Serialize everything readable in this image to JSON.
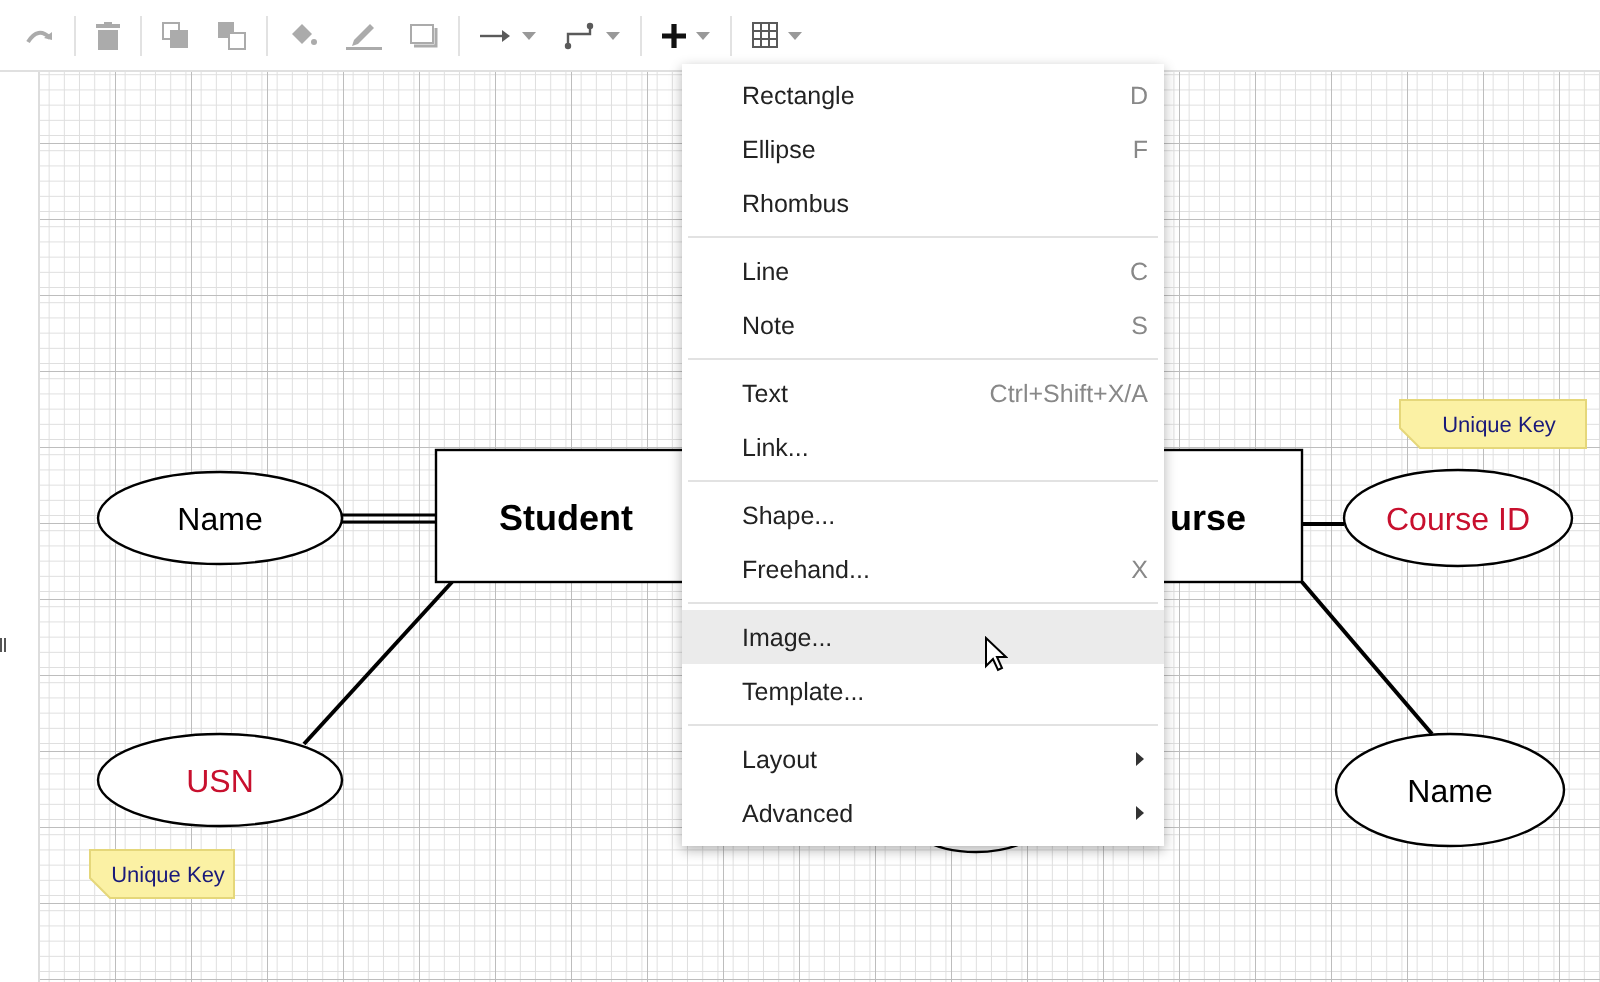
{
  "toolbar": [
    {
      "kind": "redo",
      "disabled": true
    },
    {
      "kind": "separator"
    },
    {
      "kind": "delete",
      "disabled": true
    },
    {
      "kind": "separator"
    },
    {
      "kind": "to-front",
      "disabled": true
    },
    {
      "kind": "to-back",
      "disabled": true
    },
    {
      "kind": "separator"
    },
    {
      "kind": "fill",
      "disabled": true
    },
    {
      "kind": "line-color",
      "disabled": true
    },
    {
      "kind": "shadow",
      "disabled": true
    },
    {
      "kind": "separator"
    },
    {
      "kind": "connection",
      "disabled": false
    },
    {
      "kind": "waypoint",
      "disabled": false
    },
    {
      "kind": "separator"
    },
    {
      "kind": "insert",
      "disabled": false
    },
    {
      "kind": "separator"
    },
    {
      "kind": "table",
      "disabled": false
    }
  ],
  "diagram": {
    "nodes": [
      {
        "kind": "attribute",
        "label": "Name",
        "key": false
      },
      {
        "kind": "entity",
        "label": "Student"
      },
      {
        "kind": "attribute",
        "label": "USN",
        "key": true
      },
      {
        "kind": "note",
        "label": "Unique Key"
      },
      {
        "kind": "entity",
        "label": "urse"
      },
      {
        "kind": "note",
        "label": "Unique Key"
      },
      {
        "kind": "attribute",
        "label": "Course ID",
        "key": true
      },
      {
        "kind": "attribute",
        "label": "Name",
        "key": false
      }
    ]
  },
  "menu": {
    "sections": [
      {
        "items": [
          {
            "label": "Rectangle",
            "shortcut": "D",
            "submenu": false,
            "selected": false
          },
          {
            "label": "Ellipse",
            "shortcut": "F",
            "submenu": false,
            "selected": false
          },
          {
            "label": "Rhombus",
            "submenu": false,
            "selected": false
          }
        ]
      },
      {
        "items": [
          {
            "label": "Line",
            "shortcut": "C",
            "submenu": false,
            "selected": false
          },
          {
            "label": "Note",
            "shortcut": "S",
            "submenu": false,
            "selected": false
          }
        ]
      },
      {
        "items": [
          {
            "label": "Text",
            "shortcut": "Ctrl+Shift+X/A",
            "submenu": false,
            "selected": false
          },
          {
            "label": "Link...",
            "submenu": false,
            "selected": false
          }
        ]
      },
      {
        "items": [
          {
            "label": "Shape...",
            "submenu": false,
            "selected": false
          },
          {
            "label": "Freehand...",
            "shortcut": "X",
            "submenu": false,
            "selected": false
          }
        ]
      },
      {
        "items": [
          {
            "label": "Image...",
            "submenu": false,
            "selected": true
          },
          {
            "label": "Template...",
            "submenu": false,
            "selected": false
          }
        ]
      },
      {
        "items": [
          {
            "label": "Layout",
            "submenu": true,
            "selected": false
          },
          {
            "label": "Advanced",
            "submenu": true,
            "selected": false
          }
        ]
      }
    ]
  }
}
